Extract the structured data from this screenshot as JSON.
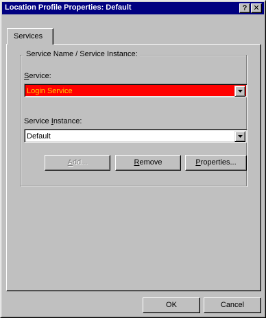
{
  "window": {
    "title": "Location Profile Properties:  Default",
    "help_label": "?",
    "close_label": "✕"
  },
  "tabs": [
    {
      "label": "Services",
      "selected": true
    }
  ],
  "group": {
    "label": "Service Name / Service Instance:"
  },
  "service": {
    "label_underlined": "S",
    "label_rest": "ervice:",
    "value": "Login Service",
    "bg_color": "#ff0000",
    "text_color": "#ffd200"
  },
  "instance": {
    "label_before": "Service ",
    "label_underlined": "I",
    "label_rest": "nstance:",
    "value": "Default"
  },
  "buttons": {
    "add": {
      "underlined": "A",
      "rest": "dd...",
      "enabled": false
    },
    "remove": {
      "underlined": "R",
      "rest": "emove",
      "enabled": true
    },
    "properties": {
      "underlined": "P",
      "rest": "roperties...",
      "enabled": true
    },
    "ok": {
      "label": "OK"
    },
    "cancel": {
      "label": "Cancel"
    }
  },
  "icons": {
    "dropdown": "chevron-down-icon",
    "help": "help-icon",
    "close": "close-icon"
  }
}
